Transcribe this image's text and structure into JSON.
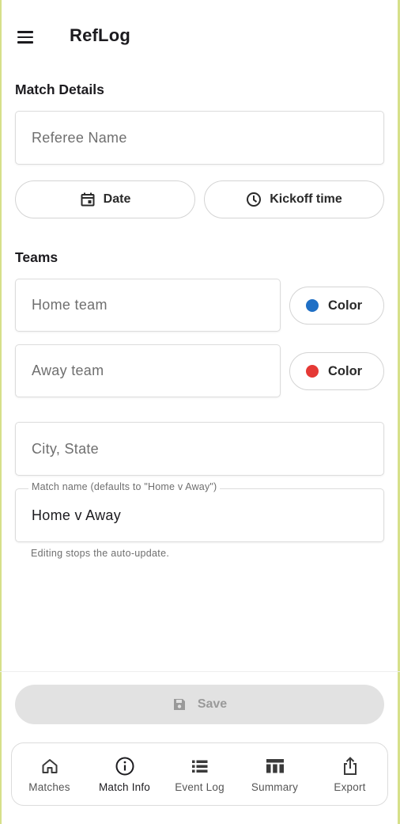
{
  "app": {
    "title": "RefLog"
  },
  "match_details": {
    "heading": "Match Details",
    "referee_placeholder": "Referee Name",
    "date_label": "Date",
    "kickoff_label": "Kickoff time"
  },
  "teams": {
    "heading": "Teams",
    "home_placeholder": "Home team",
    "home_color_label": "Color",
    "home_color": "#1f6fc5",
    "away_placeholder": "Away team",
    "away_color_label": "Color",
    "away_color": "#e53935"
  },
  "location": {
    "placeholder": "City, State"
  },
  "match_name": {
    "label": "Match name (defaults to \"Home v Away\")",
    "value": "Home v Away",
    "helper": "Editing stops the auto-update."
  },
  "save": {
    "label": "Save"
  },
  "nav": {
    "active": "Match Info",
    "items": [
      {
        "label": "Matches",
        "icon": "home-icon"
      },
      {
        "label": "Match Info",
        "icon": "info-icon"
      },
      {
        "label": "Event Log",
        "icon": "list-icon"
      },
      {
        "label": "Summary",
        "icon": "table-icon"
      },
      {
        "label": "Export",
        "icon": "share-icon"
      }
    ]
  }
}
